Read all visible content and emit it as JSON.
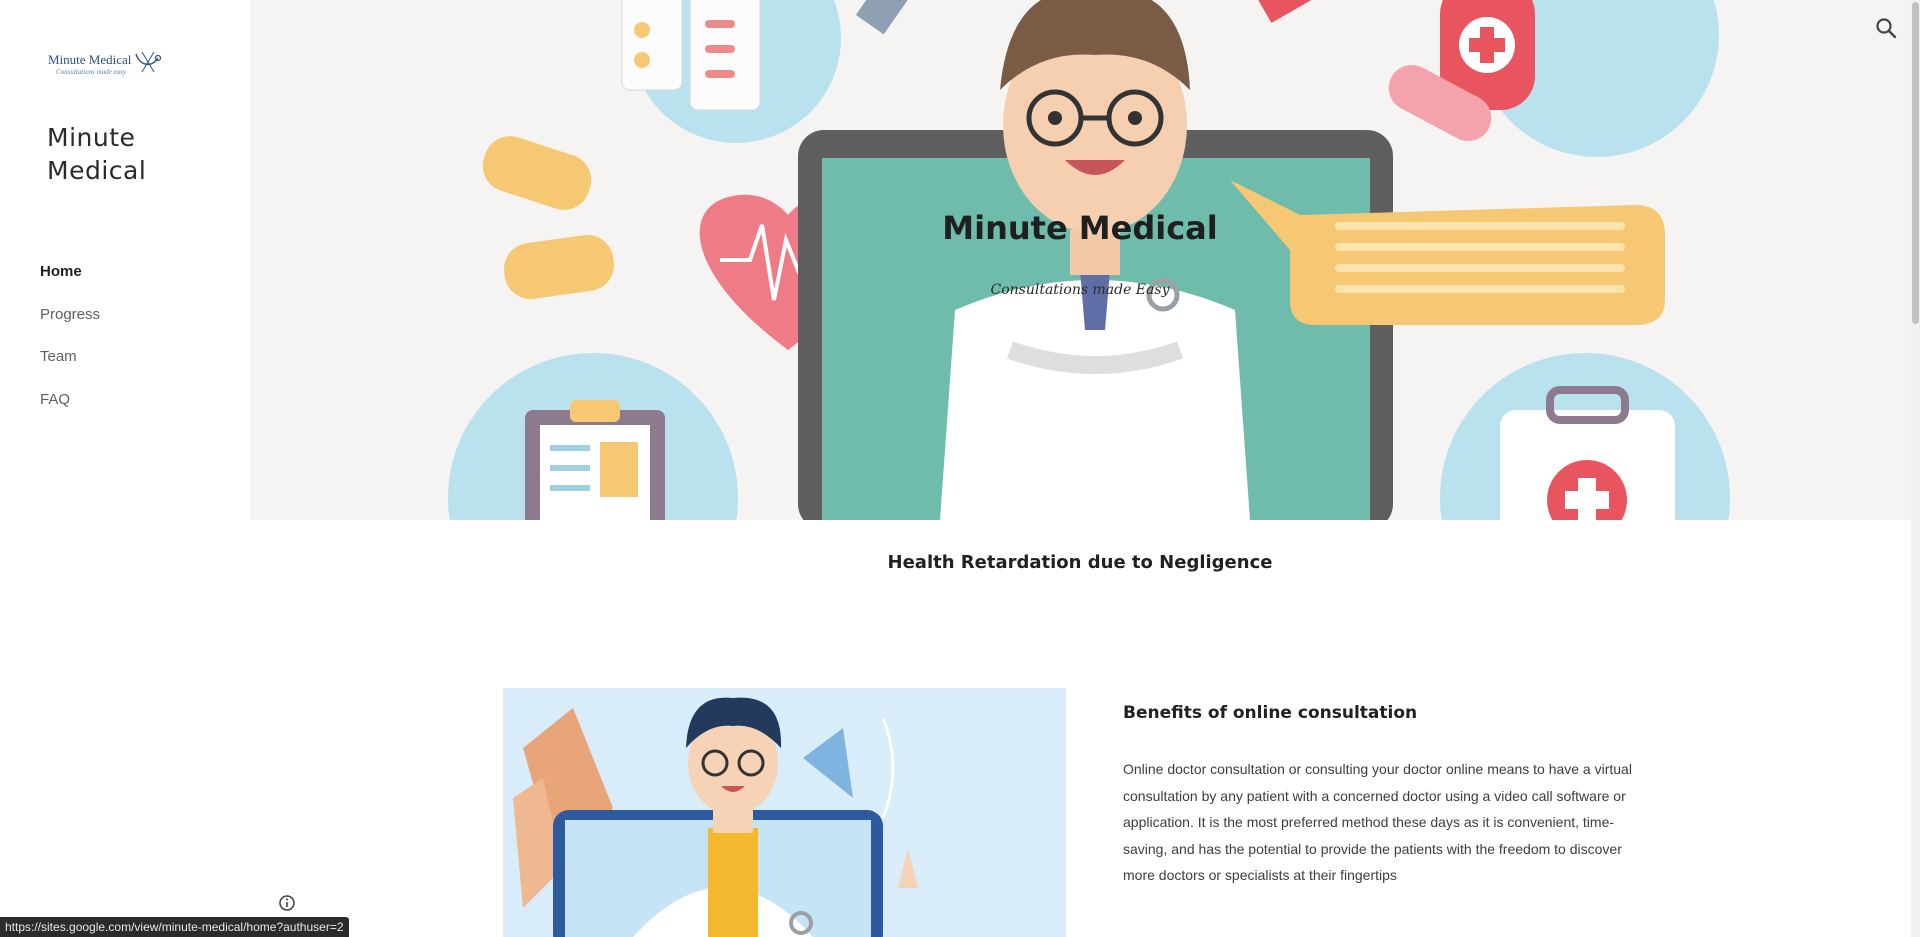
{
  "sidebar": {
    "logo": {
      "line1": "Minute Medical",
      "line2": "Consultations made easy"
    },
    "site_title": "Minute Medical",
    "nav": [
      {
        "label": "Home",
        "active": true
      },
      {
        "label": "Progress",
        "active": false
      },
      {
        "label": "Team",
        "active": false
      },
      {
        "label": "FAQ",
        "active": false
      }
    ]
  },
  "hero": {
    "title": "Minute Medical",
    "subtitle": "Consultations made Easy"
  },
  "header": {
    "search_icon": "search-icon"
  },
  "main": {
    "section_heading": "Health Retardation due to Negligence",
    "benefits": {
      "title": "Benefits of online consultation",
      "body": "Online doctor consultation or consulting your doctor online means to have a virtual consultation by any patient with a concerned doctor using a video call software or application. It is the most preferred method these days as it is convenient, time-saving, and has the potential to provide the patients with the freedom to discover more doctors or specialists at their fingertips"
    }
  },
  "footer": {
    "info_icon": "info-icon",
    "status_url": "https://sites.google.com/view/minute-medical/home?authuser=2"
  },
  "colors": {
    "hero_bg": "#f6f3f3",
    "circle_blue": "#b9e2ee",
    "monitor_teal": "#6fbcac",
    "accent_red": "#e8555f",
    "bandage_orange": "#f7c873"
  }
}
